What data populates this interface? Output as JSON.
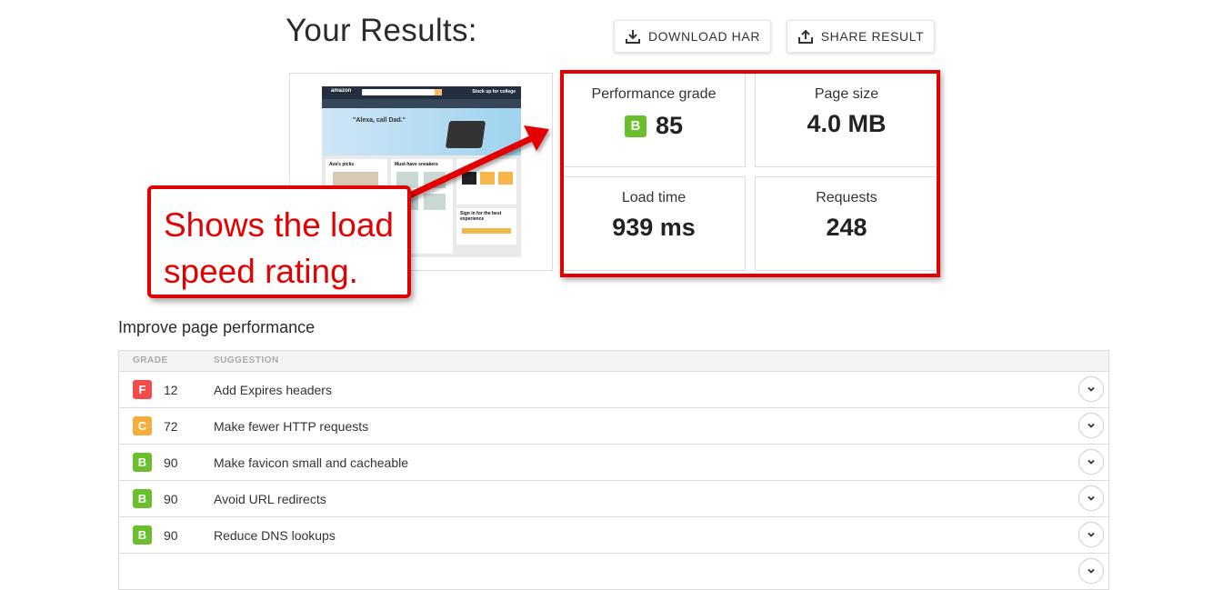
{
  "header": {
    "title": "Your Results:",
    "download_label": "DOWNLOAD HAR",
    "share_label": "SHARE RESULT"
  },
  "colors": {
    "accent_red": "#e30000",
    "grade_F": "#f24b4b",
    "grade_C": "#f5ad3b",
    "grade_B": "#6cbf2c"
  },
  "screenshot_preview": {
    "logo_text": "amazon",
    "promo_text": "Stock up for college",
    "hero_text": "\"Alexa, call Dad.\"",
    "tiles": [
      "Ava's picks",
      "Must-have sneakers",
      "Sign in for the best experience"
    ]
  },
  "metrics": {
    "performance": {
      "label": "Performance grade",
      "grade": "B",
      "value": "85"
    },
    "page_size": {
      "label": "Page size",
      "value": "4.0 MB"
    },
    "load_time": {
      "label": "Load time",
      "value": "939 ms"
    },
    "requests": {
      "label": "Requests",
      "value": "248"
    }
  },
  "callout": {
    "text": "Shows the load speed rating."
  },
  "improve": {
    "title": "Improve page performance",
    "columns": {
      "grade": "GRADE",
      "suggestion": "SUGGESTION"
    },
    "rows": [
      {
        "grade": "F",
        "score": "12",
        "suggestion": "Add Expires headers"
      },
      {
        "grade": "C",
        "score": "72",
        "suggestion": "Make fewer HTTP requests"
      },
      {
        "grade": "B",
        "score": "90",
        "suggestion": "Make favicon small and cacheable"
      },
      {
        "grade": "B",
        "score": "90",
        "suggestion": "Avoid URL redirects"
      },
      {
        "grade": "B",
        "score": "90",
        "suggestion": "Reduce DNS lookups"
      }
    ]
  }
}
